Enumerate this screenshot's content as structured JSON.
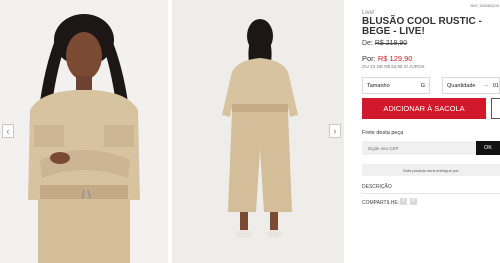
{
  "gallery": {
    "prev_arrow": "‹",
    "next_arrow": "›"
  },
  "product": {
    "reference": "Ref: 153065100",
    "brand": "Live!",
    "title": "BLUSÃO COOL RUSTIC - BEGE - LIVE!",
    "old_price_label": "De:",
    "old_price": "R$ 219,90",
    "new_price_label": "Por:",
    "new_price": "R$ 129,90",
    "installments": "OU 2X DE R$ 64,95 S/ JUROS"
  },
  "options": {
    "size_label": "Tamanho",
    "size_value": "G",
    "quantity_label": "Quantidade",
    "quantity_minus": "−",
    "quantity_value": "01"
  },
  "actions": {
    "add_to_bag": "ADICIONAR À SACOLA"
  },
  "shipping": {
    "label": "Frete desta peça",
    "cep_placeholder": "Digite seu CEP",
    "ok_label": "OK",
    "delivery_note": "Este produto será entregue por"
  },
  "details": {
    "description_label": "DESCRIÇÃO",
    "share_label": "COMPARTILHE:",
    "share_icons": [
      "f",
      "P"
    ]
  },
  "colors": {
    "accent_red": "#d1192b",
    "price_red": "#cc1f2a",
    "beige_garment": "#d8c3a0"
  }
}
